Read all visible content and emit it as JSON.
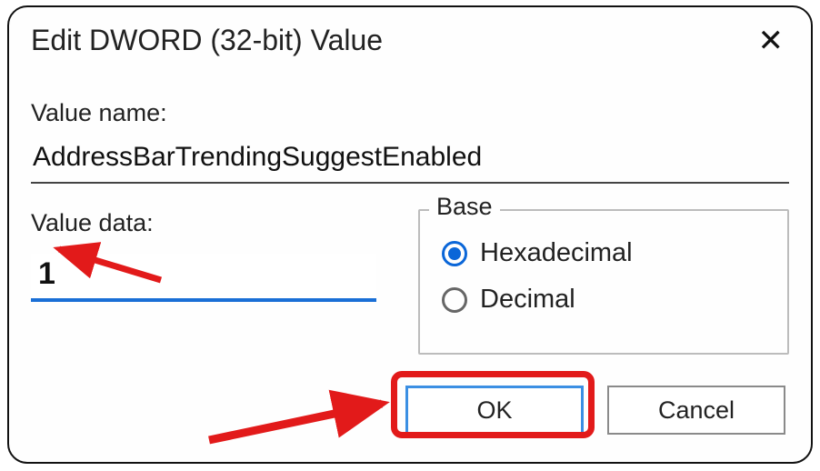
{
  "title": "Edit DWORD (32-bit) Value",
  "close_glyph": "✕",
  "value_name_label": "Value name:",
  "value_name": "AddressBarTrendingSuggestEnabled",
  "value_data_label": "Value data:",
  "value_data": "1",
  "base": {
    "legend": "Base",
    "options": {
      "hex": "Hexadecimal",
      "dec": "Decimal"
    },
    "selected": "hex"
  },
  "buttons": {
    "ok": "OK",
    "cancel": "Cancel"
  }
}
